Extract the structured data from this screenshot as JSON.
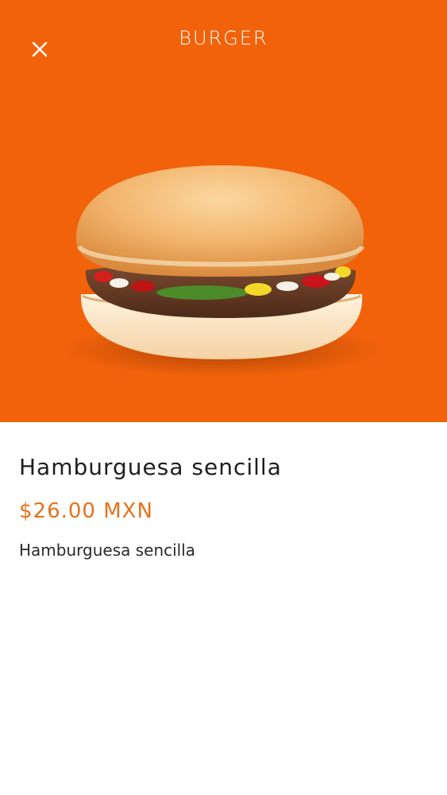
{
  "header": {
    "title": "BURGER",
    "close_icon": "close-icon"
  },
  "hero": {
    "background_color": "#f1620b",
    "image": "burger-image"
  },
  "product": {
    "name": "Hamburguesa sencilla",
    "price": "$26.00 MXN",
    "description": "Hamburguesa sencilla",
    "price_color": "#e8711b"
  }
}
